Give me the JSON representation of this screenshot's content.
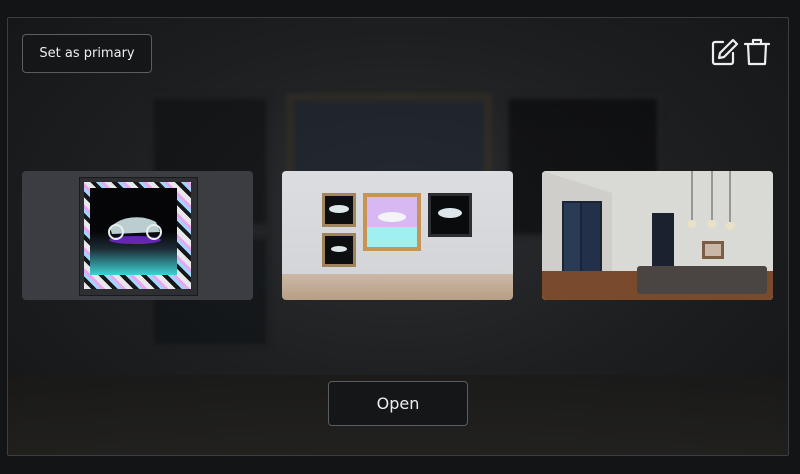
{
  "toolbar": {
    "primary_label": "Set as primary",
    "edit_icon": "edit-icon",
    "delete_icon": "trash-icon"
  },
  "thumbnails": [
    {
      "name": "artwork-preview"
    },
    {
      "name": "wall-arrangement-preview"
    },
    {
      "name": "room-preview"
    }
  ],
  "footer": {
    "open_label": "Open"
  },
  "colors": {
    "panel_border": "#3a3d41",
    "button_border": "#5a5e63",
    "text": "#eceff1",
    "selected_thumb_bg": "#3b3d42"
  }
}
